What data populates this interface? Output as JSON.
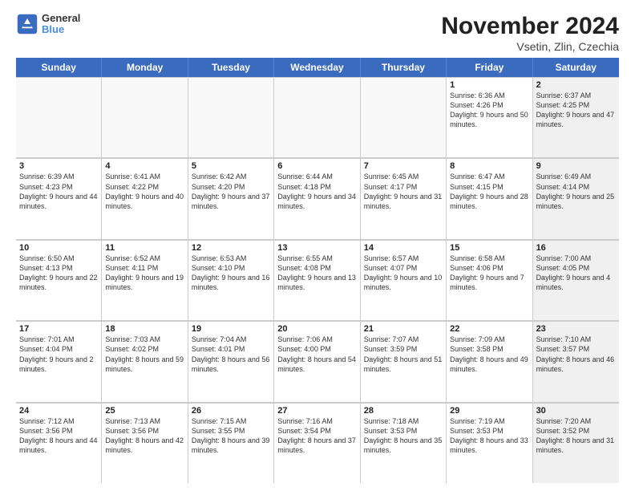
{
  "logo": {
    "line1": "General",
    "line2": "Blue"
  },
  "title": "November 2024",
  "subtitle": "Vsetin, Zlin, Czechia",
  "days": [
    "Sunday",
    "Monday",
    "Tuesday",
    "Wednesday",
    "Thursday",
    "Friday",
    "Saturday"
  ],
  "rows": [
    [
      {
        "day": "",
        "empty": true
      },
      {
        "day": "",
        "empty": true
      },
      {
        "day": "",
        "empty": true
      },
      {
        "day": "",
        "empty": true
      },
      {
        "day": "",
        "empty": true
      },
      {
        "day": "1",
        "info": "Sunrise: 6:36 AM\nSunset: 4:26 PM\nDaylight: 9 hours and 50 minutes.",
        "shaded": false
      },
      {
        "day": "2",
        "info": "Sunrise: 6:37 AM\nSunset: 4:25 PM\nDaylight: 9 hours and 47 minutes.",
        "shaded": true
      }
    ],
    [
      {
        "day": "3",
        "info": "Sunrise: 6:39 AM\nSunset: 4:23 PM\nDaylight: 9 hours and 44 minutes.",
        "shaded": false
      },
      {
        "day": "4",
        "info": "Sunrise: 6:41 AM\nSunset: 4:22 PM\nDaylight: 9 hours and 40 minutes.",
        "shaded": false
      },
      {
        "day": "5",
        "info": "Sunrise: 6:42 AM\nSunset: 4:20 PM\nDaylight: 9 hours and 37 minutes.",
        "shaded": false
      },
      {
        "day": "6",
        "info": "Sunrise: 6:44 AM\nSunset: 4:18 PM\nDaylight: 9 hours and 34 minutes.",
        "shaded": false
      },
      {
        "day": "7",
        "info": "Sunrise: 6:45 AM\nSunset: 4:17 PM\nDaylight: 9 hours and 31 minutes.",
        "shaded": false
      },
      {
        "day": "8",
        "info": "Sunrise: 6:47 AM\nSunset: 4:15 PM\nDaylight: 9 hours and 28 minutes.",
        "shaded": false
      },
      {
        "day": "9",
        "info": "Sunrise: 6:49 AM\nSunset: 4:14 PM\nDaylight: 9 hours and 25 minutes.",
        "shaded": true
      }
    ],
    [
      {
        "day": "10",
        "info": "Sunrise: 6:50 AM\nSunset: 4:13 PM\nDaylight: 9 hours and 22 minutes.",
        "shaded": false
      },
      {
        "day": "11",
        "info": "Sunrise: 6:52 AM\nSunset: 4:11 PM\nDaylight: 9 hours and 19 minutes.",
        "shaded": false
      },
      {
        "day": "12",
        "info": "Sunrise: 6:53 AM\nSunset: 4:10 PM\nDaylight: 9 hours and 16 minutes.",
        "shaded": false
      },
      {
        "day": "13",
        "info": "Sunrise: 6:55 AM\nSunset: 4:08 PM\nDaylight: 9 hours and 13 minutes.",
        "shaded": false
      },
      {
        "day": "14",
        "info": "Sunrise: 6:57 AM\nSunset: 4:07 PM\nDaylight: 9 hours and 10 minutes.",
        "shaded": false
      },
      {
        "day": "15",
        "info": "Sunrise: 6:58 AM\nSunset: 4:06 PM\nDaylight: 9 hours and 7 minutes.",
        "shaded": false
      },
      {
        "day": "16",
        "info": "Sunrise: 7:00 AM\nSunset: 4:05 PM\nDaylight: 9 hours and 4 minutes.",
        "shaded": true
      }
    ],
    [
      {
        "day": "17",
        "info": "Sunrise: 7:01 AM\nSunset: 4:04 PM\nDaylight: 9 hours and 2 minutes.",
        "shaded": false
      },
      {
        "day": "18",
        "info": "Sunrise: 7:03 AM\nSunset: 4:02 PM\nDaylight: 8 hours and 59 minutes.",
        "shaded": false
      },
      {
        "day": "19",
        "info": "Sunrise: 7:04 AM\nSunset: 4:01 PM\nDaylight: 8 hours and 56 minutes.",
        "shaded": false
      },
      {
        "day": "20",
        "info": "Sunrise: 7:06 AM\nSunset: 4:00 PM\nDaylight: 8 hours and 54 minutes.",
        "shaded": false
      },
      {
        "day": "21",
        "info": "Sunrise: 7:07 AM\nSunset: 3:59 PM\nDaylight: 8 hours and 51 minutes.",
        "shaded": false
      },
      {
        "day": "22",
        "info": "Sunrise: 7:09 AM\nSunset: 3:58 PM\nDaylight: 8 hours and 49 minutes.",
        "shaded": false
      },
      {
        "day": "23",
        "info": "Sunrise: 7:10 AM\nSunset: 3:57 PM\nDaylight: 8 hours and 46 minutes.",
        "shaded": true
      }
    ],
    [
      {
        "day": "24",
        "info": "Sunrise: 7:12 AM\nSunset: 3:56 PM\nDaylight: 8 hours and 44 minutes.",
        "shaded": false
      },
      {
        "day": "25",
        "info": "Sunrise: 7:13 AM\nSunset: 3:56 PM\nDaylight: 8 hours and 42 minutes.",
        "shaded": false
      },
      {
        "day": "26",
        "info": "Sunrise: 7:15 AM\nSunset: 3:55 PM\nDaylight: 8 hours and 39 minutes.",
        "shaded": false
      },
      {
        "day": "27",
        "info": "Sunrise: 7:16 AM\nSunset: 3:54 PM\nDaylight: 8 hours and 37 minutes.",
        "shaded": false
      },
      {
        "day": "28",
        "info": "Sunrise: 7:18 AM\nSunset: 3:53 PM\nDaylight: 8 hours and 35 minutes.",
        "shaded": false
      },
      {
        "day": "29",
        "info": "Sunrise: 7:19 AM\nSunset: 3:53 PM\nDaylight: 8 hours and 33 minutes.",
        "shaded": false
      },
      {
        "day": "30",
        "info": "Sunrise: 7:20 AM\nSunset: 3:52 PM\nDaylight: 8 hours and 31 minutes.",
        "shaded": true
      }
    ]
  ]
}
